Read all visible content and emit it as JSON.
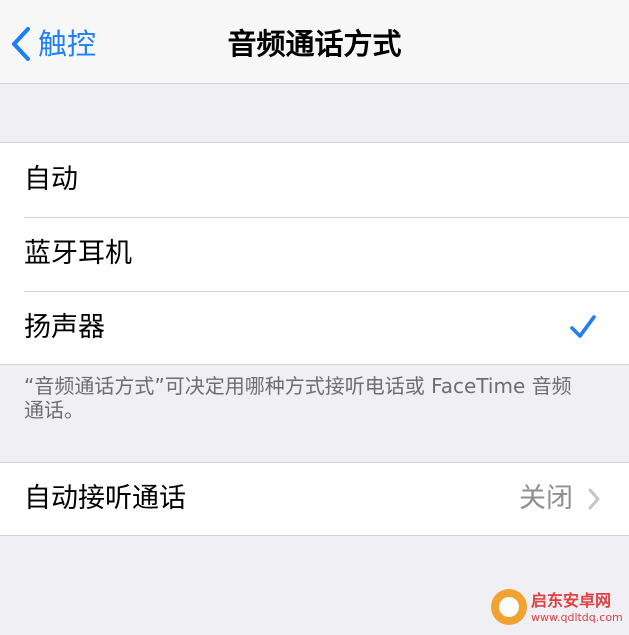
{
  "nav": {
    "back_label": "触控",
    "title": "音频通话方式"
  },
  "options": [
    {
      "label": "自动",
      "selected": false
    },
    {
      "label": "蓝牙耳机",
      "selected": false
    },
    {
      "label": "扬声器",
      "selected": true
    }
  ],
  "footer": {
    "note": "“音频通话方式”可决定用哪种方式接听电话或 FaceTime 音频通话。"
  },
  "auto_answer": {
    "label": "自动接听通话",
    "value": "关闭"
  },
  "watermark": {
    "name": "启东安卓网",
    "url": "www.qdltdq.com"
  },
  "colors": {
    "accent": "#1f7ff6",
    "background": "#efeff4",
    "separator": "#d1d1d6",
    "secondary_text": "#8e8e93"
  },
  "icons": {
    "back": "chevron-left-icon",
    "selected": "checkmark-icon",
    "disclosure": "chevron-right-icon"
  }
}
